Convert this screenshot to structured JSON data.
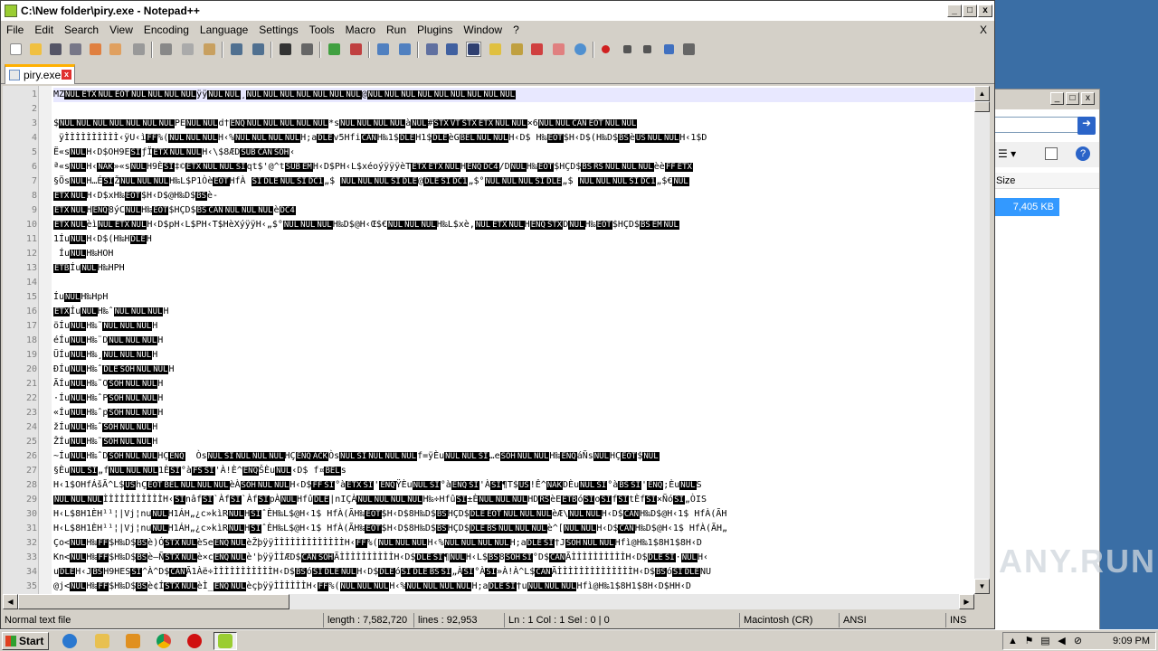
{
  "window": {
    "title": "C:\\New folder\\piry.exe - Notepad++"
  },
  "menu": [
    "File",
    "Edit",
    "Search",
    "View",
    "Encoding",
    "Language",
    "Settings",
    "Tools",
    "Macro",
    "Run",
    "Plugins",
    "Window",
    "?"
  ],
  "menu_close": "X",
  "tab": {
    "label": "piry.exe"
  },
  "editor_lines": [
    {
      "n": "1",
      "t": "MZNULETXNULEOTNULNULNULNULÿÿNULNUL¸NULNULNULNULNULNULNUL@NULNULNULNULNULNULNULNULNUL"
    },
    {
      "n": "2",
      "t": ""
    },
    {
      "n": "3",
      "t": "$NULNULNULNULNULNULNULPENULNULd†ENQNULNULNULNULNUL*sNULNULNULNULàNUL#STXVTSTXETXNULNUL×6NULNULCANEOTNULNUL"
    },
    {
      "n": "4",
      "t": " ÿÌÌÌÌÌÌÌÌÌÌ‹ÿU‹ìFF%(NULNULNULH‹%NULNULNULNULH;aDLEv5HfiCANH‰1$DLEH1$DLEèGBELNULNULH‹D$ H‰EOT$H‹D$(H‰D$BSèUSNULNULH‹1$D"
    },
    {
      "n": "5",
      "t": "Ë«sNULH‹D$OH9ESIƒÏETXNULNULH‹\\$8ÆDSUBCANSOH‹"
    },
    {
      "n": "6",
      "t": "ª«sNULH‹NAK»«sNULH9ÈSI‡©ETXNULNULSIqt$'@^tSUBEMH‹D$PH‹L$xéoýÿÿÿèTETXETXNULHENQDC4/DNULH‰EOT$HÇD$BSRSNULNULNULèèFFETX"
    },
    {
      "n": "7",
      "t": "§ÖsNULH…ÉSIŽNULNULNULH‰L$P1ÒèEOTHfÀ SIDLENULSIDC1„$ NULNULNULSIDLE@DLESIDC1„$°NULNULNULSIDLE„$ NULNULNULSIDC1„$€NUL"
    },
    {
      "n": "8",
      "t": "ETXNULH‹D$xH‰EOT$H‹D$@H‰D$BSè-"
    },
    {
      "n": "9",
      "t": "ETXNULHENQ8ýCNULH‰EOT$HÇD$BSCANNULNULNULèDC4"
    },
    {
      "n": "10",
      "t": "ETXNULèìNULETXNULH‹D$pH‹L$PH‹T$HèXýÿÿH‹„$°NULNULNULH‰D$@H‹Œ$€NULNULNULH‰L$xè,NULETXNULHENQSTXDNULH‰EOT$HÇD$BSEMNUL"
    },
    {
      "n": "11",
      "t": "1ÍuNULH‹D$(H‰HDLEH"
    },
    {
      "n": "12",
      "t": " ÍuNULH‰HOH"
    },
    {
      "n": "13",
      "t": "ETBÍuNULH‰HPH"
    },
    {
      "n": "14",
      "t": ""
    },
    {
      "n": "15",
      "t": "ÍuNULH‰HpH"
    },
    {
      "n": "16",
      "t": "ETXÍuNULH‰ˆNULNULNULH"
    },
    {
      "n": "17",
      "t": "öÍuNULH‰˜NULNULNULH"
    },
    {
      "n": "18",
      "t": "éÍuNULH‰¨DNULNULNULH"
    },
    {
      "n": "19",
      "t": "ÜÍuNULH‰¸NULNULNULH"
    },
    {
      "n": "20",
      "t": "ÐÍuNULH‰ˆDLESOHNULNULH"
    },
    {
      "n": "21",
      "t": "ÃÍuNULH‰˜OSOHNULNULH"
    },
    {
      "n": "22",
      "t": "·ÍuNULH‰ˆPSOHNULNULH"
    },
    {
      "n": "23",
      "t": "«ÍuNULH‰ˆpSOHNULNULH"
    },
    {
      "n": "24",
      "t": "žÍuNULH‰ˆSOHNULNULH"
    },
    {
      "n": "25",
      "t": "ŽÍuNULH‰˜SOHNULNULH"
    },
    {
      "n": "26",
      "t": "~ÍuNULH‰ˆDSOHNULNULHÇENQ  ÒsNULSINULNULNULHÇENQACKÒsNULSINULNULNULf=ÿÈuNULNULSI…eSOHNULNULH‰ENQáÑsNULHÇEOT$NUL"
    },
    {
      "n": "27",
      "t": "§ÈuNULSI„fNULNULNUL1ÈSI°àFSSI'À!È^ENQŠÈuNUL‹D$ f¤BELs"
    },
    {
      "n": "28",
      "t": "H‹1$OHfÁšÃ^L$UShÇEOTBELNULNULNULèÀSOHNULNULH‹D$FFSI°àETXSI'ENQŸÈuNULSI°àENQSI'ÀSI¶T$US!Ê^NAKDÈuNULSI°àBSSI'ENQ;ÈuNULS"
    },
    {
      "n": "29",
      "t": "NULNULNULÌÌÌÌÌÌÌÌÌÌÌH‹SInâfSI`ÀfSI`ÀfSIpÀNULHfûDLE|nIÇÀNULNULNULNULH‰÷HfûSI±ÈNULNULNULHDRSèEETBóSIoSIfSItÈfSI×ÑóSI„ÒIS"
    },
    {
      "n": "30",
      "t": "H‹L$8H1ÈH¹¹¦|Vj¦nuNULH1ÁH„¿c»kìRNULHSIˆÈH‰L$@H‹1$ HfÀ(ÃH‰EOT$H‹D$8H‰D$BSHÇD$DLEEOTNULNULNULèÆ\\NULNULH‹D$CANH‰D$@H‹1$ HfÀ(ÃH"
    },
    {
      "n": "31",
      "t": "H‹L$8H1ÈH¹¹¦|Vj¦nuNULH1ÁH„¿c»kìRNULHSIˆÈH‰L$@H‹1$ HfÀ(ÃH‰EOT$H‹D$8H‰D$BSHÇD$DLEBSNULNULNULè^[NULNULH‹D$CANH‰D$@H‹1$ HfÀ(ÃH„"
    },
    {
      "n": "32",
      "t": "Ço<NULH‰FF$H‰D$BSè)ÓSTXNULèSeENQNULèŽþÿÿÌÌÌÌÌÌÌÌÌÌÌÌÌH‹FF%(NULNULNULH‹%NULNULNULNULH;aDLESI†JSOHNULNULHfì@H‰1$8H1$8H‹D"
    },
    {
      "n": "33",
      "t": "Kn<NULH‰FF$H‰D$BSè–ÑSTXNULè×cENQNULè'þÿÿÌÌÆD$CANSOHÃÌÌÌÌÌÌÌÌÌÌH‹D$DLESI¶NULH‹L$BS8SOHSI°D$CANÃÌÌÌÌÌÌÌÌÌÌH‹D$DLESI·NULH‹"
    },
    {
      "n": "34",
      "t": "uDLEH‹JBSH9HESSI^À^D$CANÃ1Àë÷ÌÌÌÌÌÌÌÌÌÌÌH‹D$BSóSIDLENULH‹D$DLEóSIDLEBSSI„ÀSI°ÀSI»À!À^L$CANÃÌÌÌÌÌÌÌÌÌÌÌÌÌÌH‹D$BSóSIDLENU"
    },
    {
      "n": "35",
      "t": "@j<NULH‰FF$H‰D$BSè¢ÍSTXNULèÌ_ENQNULèçþÿÿÌÌÌÌÌÌH‹FF%(NULNULNULH‹%NULNULNULNULH;aDLESI†uNULNULNULHfì@H‰1$8H1$8H‹D$HH‹D"
    }
  ],
  "status": {
    "type": "Normal text file",
    "length": "length : 7,582,720",
    "lines": "lines : 92,953",
    "pos": "Ln : 1    Col : 1    Sel : 0 | 0",
    "eol": "Macintosh (CR)",
    "encoding": "ANSI",
    "mode": "INS"
  },
  "background_window": {
    "column_header": "Size",
    "selected_size": "7,405 KB"
  },
  "taskbar": {
    "start": "Start",
    "clock": "9:09 PM"
  },
  "watermark": "ANY.RUN"
}
